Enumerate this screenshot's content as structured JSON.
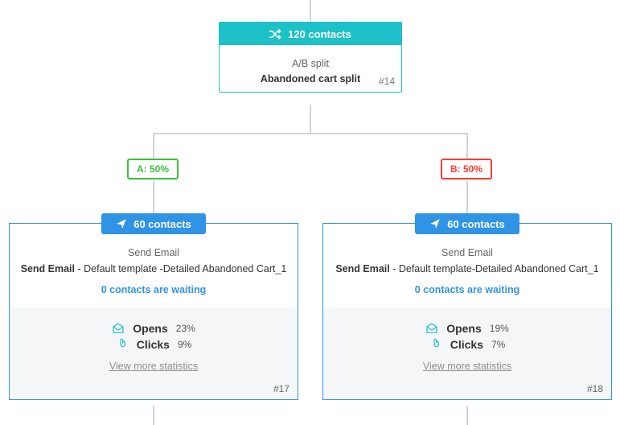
{
  "split": {
    "contacts_label": "120 contacts",
    "subtitle": "A/B split",
    "name": "Abandoned cart split",
    "id": "#14"
  },
  "branches": {
    "a": {
      "pill": "A: 50%",
      "contacts_label": "60 contacts",
      "type_label": "Send Email",
      "desc_prefix": "Send Email",
      "desc_rest": " - Default template -Detailed Abandoned Cart_1",
      "waiting_label": "0 contacts are waiting",
      "opens_label": "Opens",
      "opens_pct": "23%",
      "clicks_label": "Clicks",
      "clicks_pct": "9%",
      "view_more": "View more statistics",
      "id": "#17"
    },
    "b": {
      "pill": "B: 50%",
      "contacts_label": "60 contacts",
      "type_label": "Send Email",
      "desc_prefix": "Send Email",
      "desc_rest": " - Default template-Detailed Abandoned Cart_1",
      "waiting_label": "0 contacts are waiting",
      "opens_label": "Opens",
      "opens_pct": "19%",
      "clicks_label": "Clicks",
      "clicks_pct": "7%",
      "view_more": "View more statistics",
      "id": "#18"
    }
  },
  "colors": {
    "teal": "#1dc1c8",
    "blue": "#2f94e6",
    "green": "#3bbf3b",
    "red": "#ff3b30"
  }
}
